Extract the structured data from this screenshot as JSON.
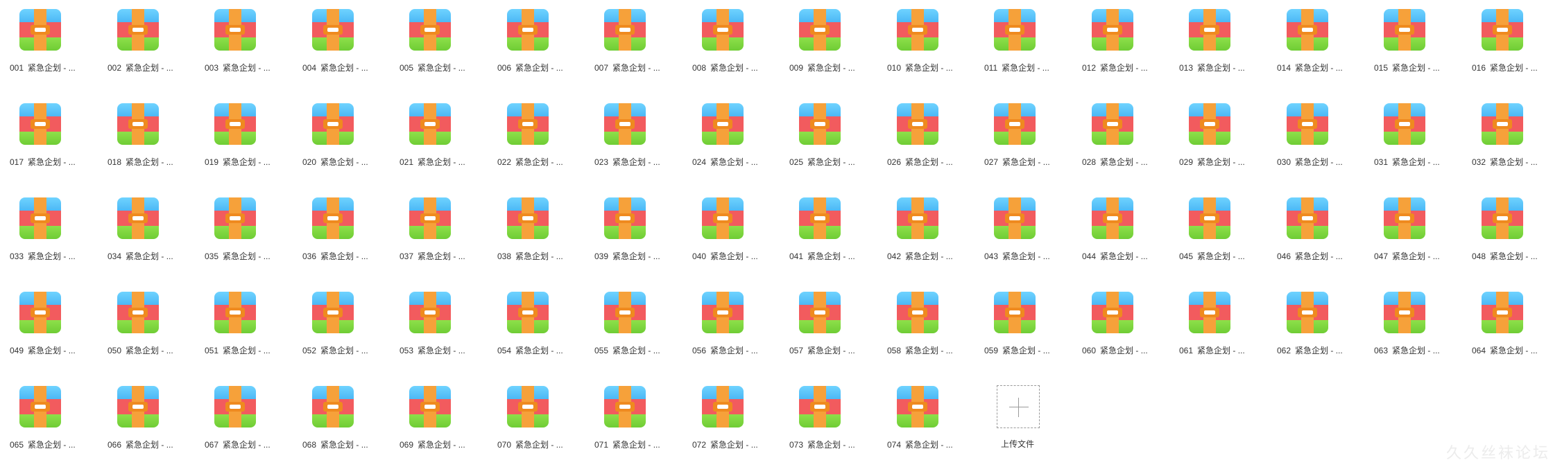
{
  "file_name_suffix": "紧急企划 - ...",
  "files": [
    "001",
    "002",
    "003",
    "004",
    "005",
    "006",
    "007",
    "008",
    "009",
    "010",
    "011",
    "012",
    "013",
    "014",
    "015",
    "016",
    "017",
    "018",
    "019",
    "020",
    "021",
    "022",
    "023",
    "024",
    "025",
    "026",
    "027",
    "028",
    "029",
    "030",
    "031",
    "032",
    "033",
    "034",
    "035",
    "036",
    "037",
    "038",
    "039",
    "040",
    "041",
    "042",
    "043",
    "044",
    "045",
    "046",
    "047",
    "048",
    "049",
    "050",
    "051",
    "052",
    "053",
    "054",
    "055",
    "056",
    "057",
    "058",
    "059",
    "060",
    "061",
    "062",
    "063",
    "064",
    "065",
    "066",
    "067",
    "068",
    "069",
    "070",
    "071",
    "072",
    "073",
    "074"
  ],
  "file_icon": "archive-file-icon",
  "upload": {
    "label": "上传文件",
    "icon": "plus-icon"
  },
  "watermark": "久久丝袜论坛",
  "colors": {
    "icon_top": "#4cb8f5",
    "icon_mid": "#f25b5e",
    "icon_bottom": "#6fcd35",
    "icon_strap": "#f6a13a",
    "text": "#333333"
  }
}
